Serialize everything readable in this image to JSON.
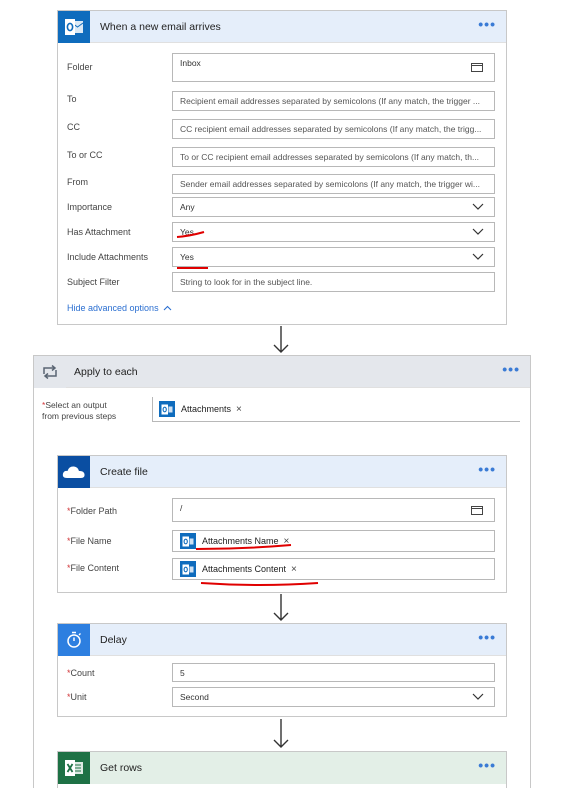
{
  "trigger": {
    "title": "When a new email arrives",
    "more": "•••",
    "fields": [
      {
        "label": "Folder",
        "value": "Inbox"
      },
      {
        "label": "To",
        "value": "Recipient email addresses separated by semicolons (If any match, the trigger ..."
      },
      {
        "label": "CC",
        "value": "CC recipient email addresses separated by semicolons (If any match, the trigg..."
      },
      {
        "label": "To or CC",
        "value": "To or CC recipient email addresses separated by semicolons (If any match, th..."
      },
      {
        "label": "From",
        "value": "Sender email addresses separated by semicolons (If any match, the trigger wi..."
      },
      {
        "label": "Importance",
        "value": "Any"
      },
      {
        "label": "Has Attachment",
        "value": "Yes"
      },
      {
        "label": "Include Attachments",
        "value": "Yes"
      },
      {
        "label": "Subject Filter",
        "value": "String to look for in the subject line."
      }
    ],
    "advanced_link": "Hide advanced options"
  },
  "apply_each": {
    "title": "Apply to each",
    "more": "•••",
    "req": "*",
    "label_line1": "Select an output",
    "label_line2": "from previous steps",
    "token": "Attachments",
    "token_x": "×"
  },
  "create_file": {
    "title": "Create file",
    "more": "•••",
    "req": "*",
    "folder_label": "Folder Path",
    "folder_value": "/",
    "name_label": "File Name",
    "name_token": "Attachments Name",
    "content_label": "File Content",
    "content_token": "Attachments Content",
    "token_x": "×"
  },
  "delay": {
    "title": "Delay",
    "more": "•••",
    "req": "*",
    "count_label": "Count",
    "count_value": "5",
    "unit_label": "Unit",
    "unit_value": "Second"
  },
  "get_rows": {
    "title": "Get rows",
    "more": "•••"
  },
  "colors": {
    "outlook_blue": "#0f6cbd",
    "excel_green": "#1e7145",
    "onedrive_blue": "#0a4ea2",
    "annotation_red": "#e00000",
    "link_blue": "#2b6fd1"
  }
}
